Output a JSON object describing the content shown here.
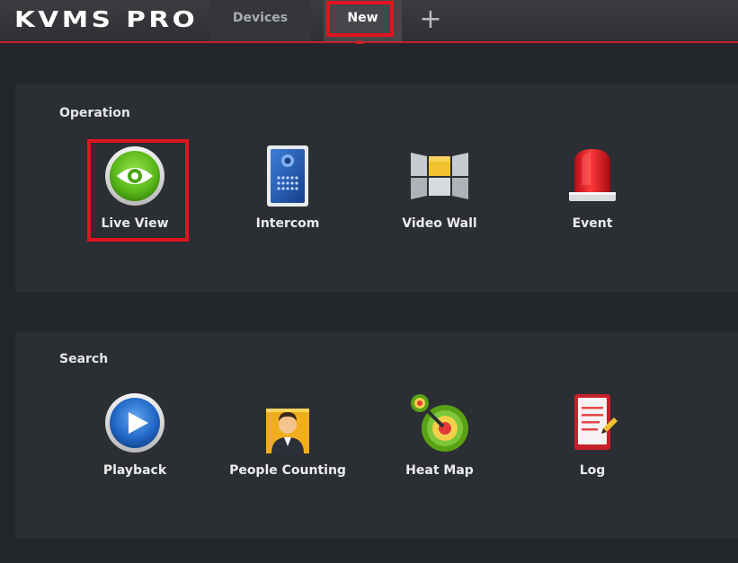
{
  "app": {
    "logo": "KVMS PRO"
  },
  "tabs": [
    {
      "label": "Devices"
    },
    {
      "label": "New"
    }
  ],
  "add_tab": {
    "symbol": "+"
  },
  "sections": {
    "operation": {
      "title": "Operation",
      "items": [
        {
          "label": "Live View",
          "icon": "eye-icon"
        },
        {
          "label": "Intercom",
          "icon": "intercom-panel-icon"
        },
        {
          "label": "Video Wall",
          "icon": "video-wall-icon"
        },
        {
          "label": "Event",
          "icon": "alarm-siren-icon"
        }
      ]
    },
    "search": {
      "title": "Search",
      "items": [
        {
          "label": "Playback",
          "icon": "play-icon"
        },
        {
          "label": "People Counting",
          "icon": "person-icon"
        },
        {
          "label": "Heat Map",
          "icon": "heat-map-icon"
        },
        {
          "label": "Log",
          "icon": "log-document-icon"
        }
      ]
    }
  },
  "colors": {
    "accent_red": "#e3141f",
    "background": "#23262b",
    "panel": "#2b2e33"
  }
}
